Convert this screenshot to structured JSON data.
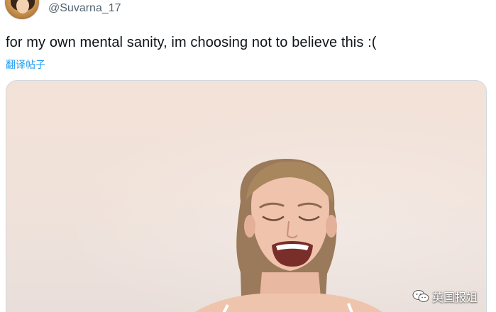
{
  "tweet": {
    "handle": "@Suvarna_17",
    "text": "for my own mental sanity, im choosing not to believe this :(",
    "translate_label": "翻译帖子"
  },
  "watermark": {
    "label": "英国报姐",
    "icon": "wechat-icon"
  },
  "colors": {
    "link": "#1d9bf0",
    "text": "#0f1419",
    "secondary": "#536471",
    "border": "#cfd9de"
  }
}
